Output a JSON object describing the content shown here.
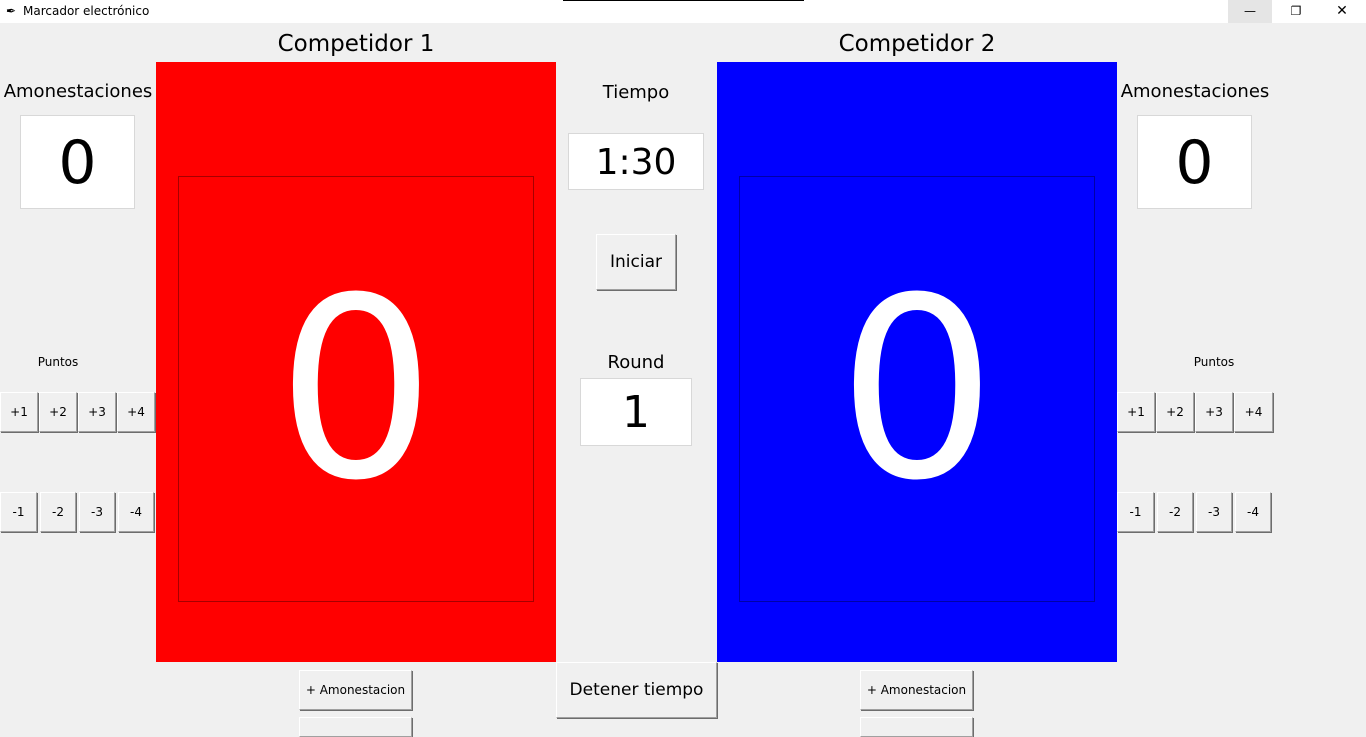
{
  "window": {
    "title": "Marcador electrónico",
    "controls": {
      "minimize": "—",
      "restore": "❐",
      "close": "✕"
    }
  },
  "competitor1": {
    "name": "Competidor 1",
    "color": "#ff0000",
    "score": "0",
    "warnings_label": "Amonestaciones",
    "warnings": "0",
    "points_label": "Puntos",
    "add_points": [
      "+1",
      "+2",
      "+3",
      "+4"
    ],
    "sub_points": [
      "-1",
      "-2",
      "-3",
      "-4"
    ],
    "add_warning": "+ Amonestacion"
  },
  "competitor2": {
    "name": "Competidor 2",
    "color": "#0000ff",
    "score": "0",
    "warnings_label": "Amonestaciones",
    "warnings": "0",
    "points_label": "Puntos",
    "add_points": [
      "+1",
      "+2",
      "+3",
      "+4"
    ],
    "sub_points": [
      "-1",
      "-2",
      "-3",
      "-4"
    ],
    "add_warning": "+ Amonestacion"
  },
  "center": {
    "time_label": "Tiempo",
    "time": "1:30",
    "start_button": "Iniciar",
    "round_label": "Round",
    "round": "1",
    "stop_button": "Detener tiempo"
  }
}
